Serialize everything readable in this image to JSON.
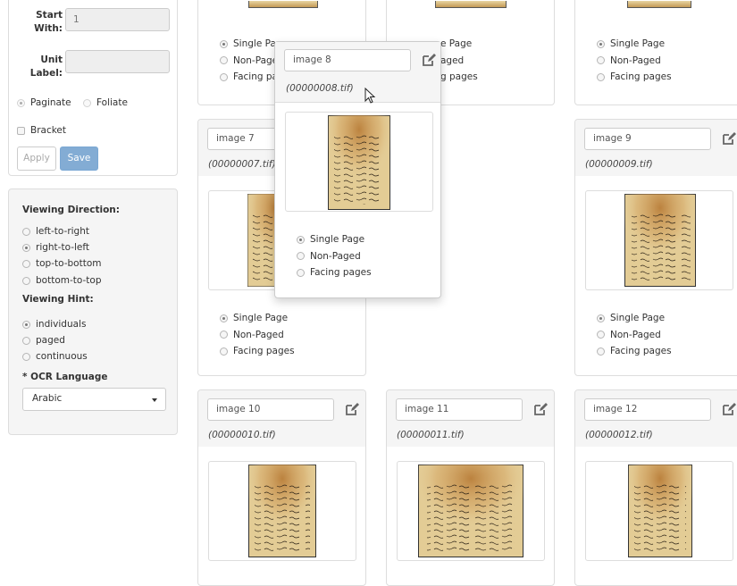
{
  "settings": {
    "start_with_label": "Start With:",
    "start_with_value": "1",
    "unit_label_label": "Unit Label:",
    "unit_label_value": "",
    "numbering": [
      {
        "label": "Paginate",
        "selected": true
      },
      {
        "label": "Foliate",
        "selected": false
      }
    ],
    "bracket_label": "Bracket",
    "apply_label": "Apply",
    "save_label": "Save"
  },
  "viewing": {
    "direction_heading": "Viewing Direction:",
    "directions": [
      {
        "label": "left-to-right",
        "selected": false
      },
      {
        "label": "right-to-left",
        "selected": true
      },
      {
        "label": "top-to-bottom",
        "selected": false
      },
      {
        "label": "bottom-to-top",
        "selected": false
      }
    ],
    "hint_heading": "Viewing Hint:",
    "hints": [
      {
        "label": "individuals",
        "selected": true
      },
      {
        "label": "paged",
        "selected": false
      },
      {
        "label": "continuous",
        "selected": false
      }
    ],
    "ocr_heading": "* OCR Language",
    "ocr_value": "Arabic"
  },
  "page_types": [
    "Single Page",
    "Non-Paged",
    "Facing pages"
  ],
  "page_types_partial": [
    "e Page",
    "aged",
    "g pages"
  ],
  "page_types_cut": [
    "Single Pag",
    "Non-Pagec",
    "Facing pag"
  ],
  "cards": {
    "image7": {
      "name": "image 7",
      "file": "(00000007.tif)"
    },
    "image8": {
      "name": "image 8",
      "file": "(00000008.tif)"
    },
    "image9": {
      "name": "image 9",
      "file": "(00000009.tif)"
    },
    "image10": {
      "name": "image 10",
      "file": "(00000010.tif)"
    },
    "image11": {
      "name": "image 11",
      "file": "(00000011.tif)"
    },
    "image12": {
      "name": "image 12",
      "file": "(00000012.tif)"
    }
  },
  "colors": {
    "primary": "#83acd4",
    "panel_bg": "#f5f5f5",
    "parchment": "#e3cc95",
    "stain": "#c18a45"
  }
}
